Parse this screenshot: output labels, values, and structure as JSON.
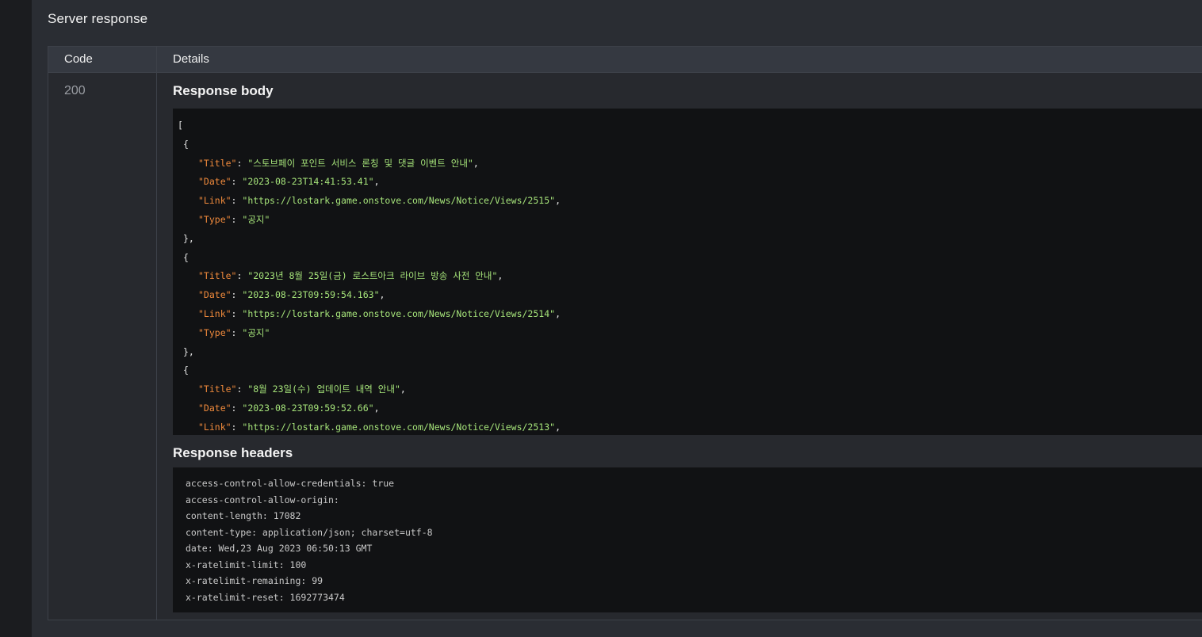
{
  "section_title": "Server response",
  "table": {
    "col_code": "Code",
    "col_details": "Details",
    "code_value": "200"
  },
  "response_body": {
    "title": "Response body",
    "open_bracket": "[",
    "items": [
      {
        "open": "{",
        "title_key": "\"Title\"",
        "title_val": "\"스토브페이 포인트 서비스 론칭 및 댓글 이벤트 안내\"",
        "date_key": "\"Date\"",
        "date_val": "\"2023-08-23T14:41:53.41\"",
        "link_key": "\"Link\"",
        "link_val": "\"https://lostark.game.onstove.com/News/Notice/Views/2515\"",
        "type_key": "\"Type\"",
        "type_val": "\"공지\"",
        "close": "},"
      },
      {
        "open": "{",
        "title_key": "\"Title\"",
        "title_val": "\"2023년 8월 25일(금) 로스트아크 라이브 방송 사전 안내\"",
        "date_key": "\"Date\"",
        "date_val": "\"2023-08-23T09:59:54.163\"",
        "link_key": "\"Link\"",
        "link_val": "\"https://lostark.game.onstove.com/News/Notice/Views/2514\"",
        "type_key": "\"Type\"",
        "type_val": "\"공지\"",
        "close": "},"
      },
      {
        "open": "{",
        "title_key": "\"Title\"",
        "title_val": "\"8월 23일(수) 업데이트 내역 안내\"",
        "date_key": "\"Date\"",
        "date_val": "\"2023-08-23T09:59:52.66\"",
        "link_key": "\"Link\"",
        "link_val": "\"https://lostark.game.onstove.com/News/Notice/Views/2513\""
      }
    ]
  },
  "response_headers": {
    "title": "Response headers",
    "lines": [
      "access-control-allow-credentials: true",
      "access-control-allow-origin:",
      "content-length: 17082",
      "content-type: application/json; charset=utf-8",
      "date: Wed,23 Aug 2023 06:50:13 GMT",
      "x-ratelimit-limit: 100",
      "x-ratelimit-remaining: 99",
      "x-ratelimit-reset: 1692773474"
    ]
  },
  "colors": {
    "background": "#2a2d33",
    "code_bg": "#111214",
    "json_key": "#f08a3c",
    "json_string": "#a6e47a"
  }
}
